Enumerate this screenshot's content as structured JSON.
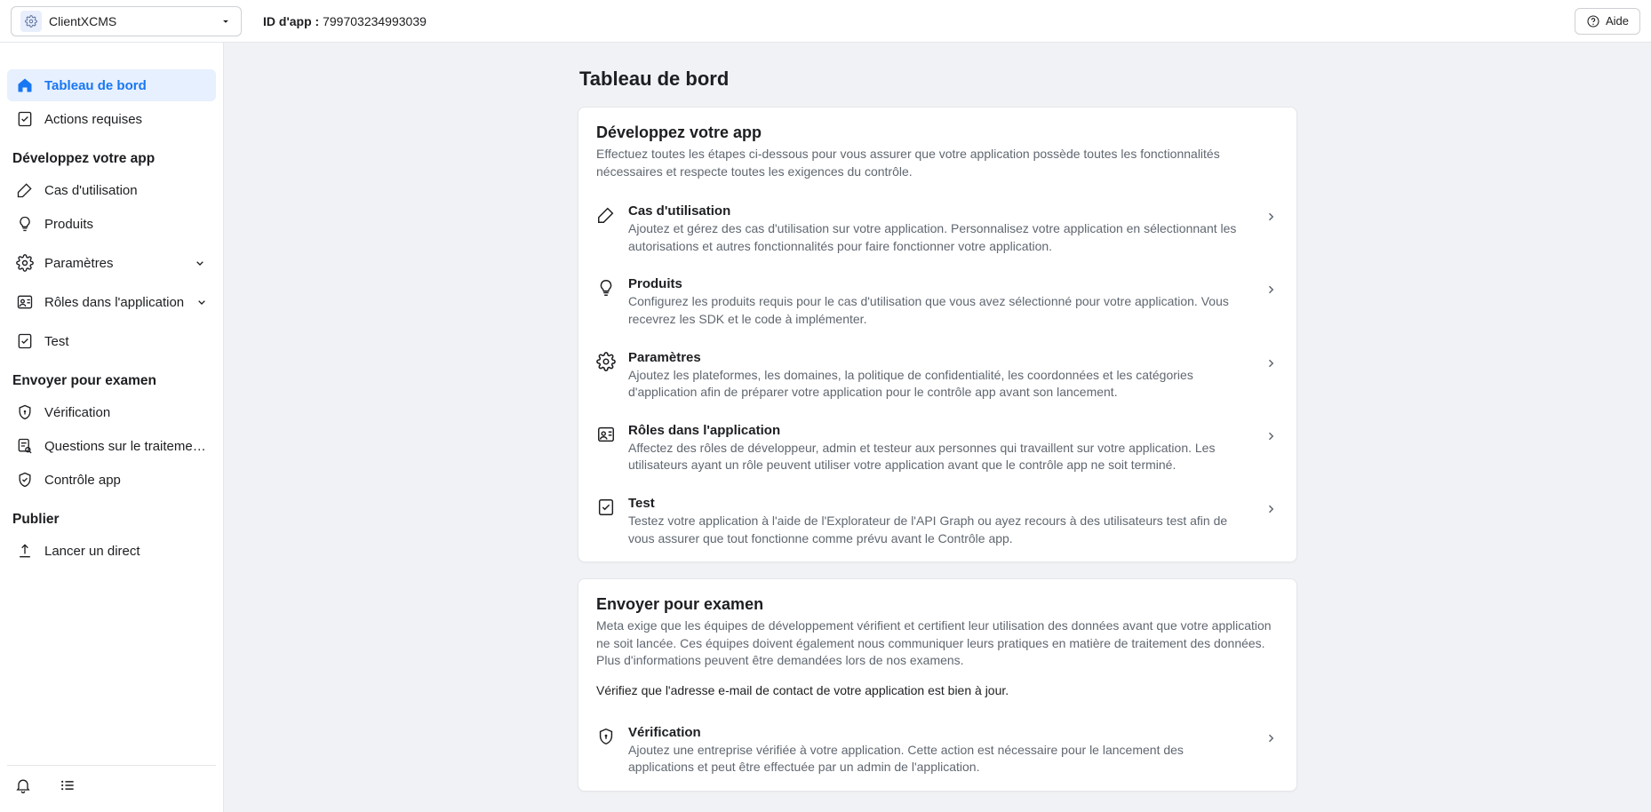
{
  "header": {
    "app_name": "ClientXCMS",
    "appid_label": "ID d'app :",
    "appid_value": "799703234993039",
    "help_label": "Aide"
  },
  "sidebar": {
    "dashboard": "Tableau de bord",
    "required_actions": "Actions requises",
    "section_build": "Développez votre app",
    "use_cases": "Cas d'utilisation",
    "products": "Produits",
    "settings": "Paramètres",
    "roles": "Rôles dans l'application",
    "test": "Test",
    "section_review": "Envoyer pour examen",
    "verification": "Vérification",
    "data_questions": "Questions sur le traitement de...",
    "app_review": "Contrôle app",
    "section_publish": "Publier",
    "go_live": "Lancer un direct"
  },
  "main": {
    "title": "Tableau de bord",
    "build": {
      "title": "Développez votre app",
      "sub": "Effectuez toutes les étapes ci-dessous pour vous assurer que votre application possède toutes les fonctionnalités nécessaires et respecte toutes les exigences du contrôle.",
      "rows": [
        {
          "title": "Cas d'utilisation",
          "desc": "Ajoutez et gérez des cas d'utilisation sur votre application. Personnalisez votre application en sélectionnant les autorisations et autres fonctionnalités pour faire fonctionner votre application."
        },
        {
          "title": "Produits",
          "desc": "Configurez les produits requis pour le cas d'utilisation que vous avez sélectionné pour votre application. Vous recevrez les SDK et le code à implémenter."
        },
        {
          "title": "Paramètres",
          "desc": "Ajoutez les plateformes, les domaines, la politique de confidentialité, les coordonnées et les catégories d'application afin de préparer votre application pour le contrôle app avant son lancement."
        },
        {
          "title": "Rôles dans l'application",
          "desc": "Affectez des rôles de développeur, admin et testeur aux personnes qui travaillent sur votre application. Les utilisateurs ayant un rôle peuvent utiliser votre application avant que le contrôle app ne soit terminé."
        },
        {
          "title": "Test",
          "desc": "Testez votre application à l'aide de l'Explorateur de l'API Graph ou ayez recours à des utilisateurs test afin de vous assurer que tout fonctionne comme prévu avant le Contrôle app."
        }
      ]
    },
    "review": {
      "title": "Envoyer pour examen",
      "sub": "Meta exige que les équipes de développement vérifient et certifient leur utilisation des données avant que votre application ne soit lancée. Ces équipes doivent également nous communiquer leurs pratiques en matière de traitement des données. Plus d'informations peuvent être demandées lors de nos examens.",
      "note": "Vérifiez que l'adresse e-mail de contact de votre application est bien à jour.",
      "rows": [
        {
          "title": "Vérification",
          "desc": "Ajoutez une entreprise vérifiée à votre application. Cette action est nécessaire pour le lancement des applications et peut être effectuée par un admin de l'application."
        }
      ]
    }
  }
}
